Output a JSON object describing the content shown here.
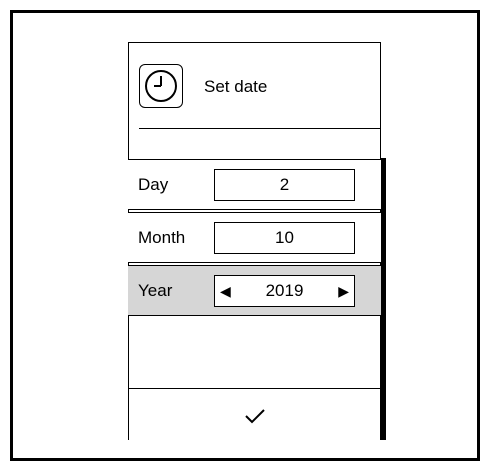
{
  "dialog": {
    "title": "Set date",
    "icon": "clock-icon",
    "confirm_icon": "checkmark-icon"
  },
  "fields": [
    {
      "label": "Day",
      "value": "2",
      "selected": false
    },
    {
      "label": "Month",
      "value": "10",
      "selected": false
    },
    {
      "label": "Year",
      "value": "2019",
      "selected": true
    }
  ],
  "arrows": {
    "left": "◀",
    "right": "▶"
  },
  "colors": {
    "selected_row": "#d6d6d6",
    "border": "#000000"
  }
}
